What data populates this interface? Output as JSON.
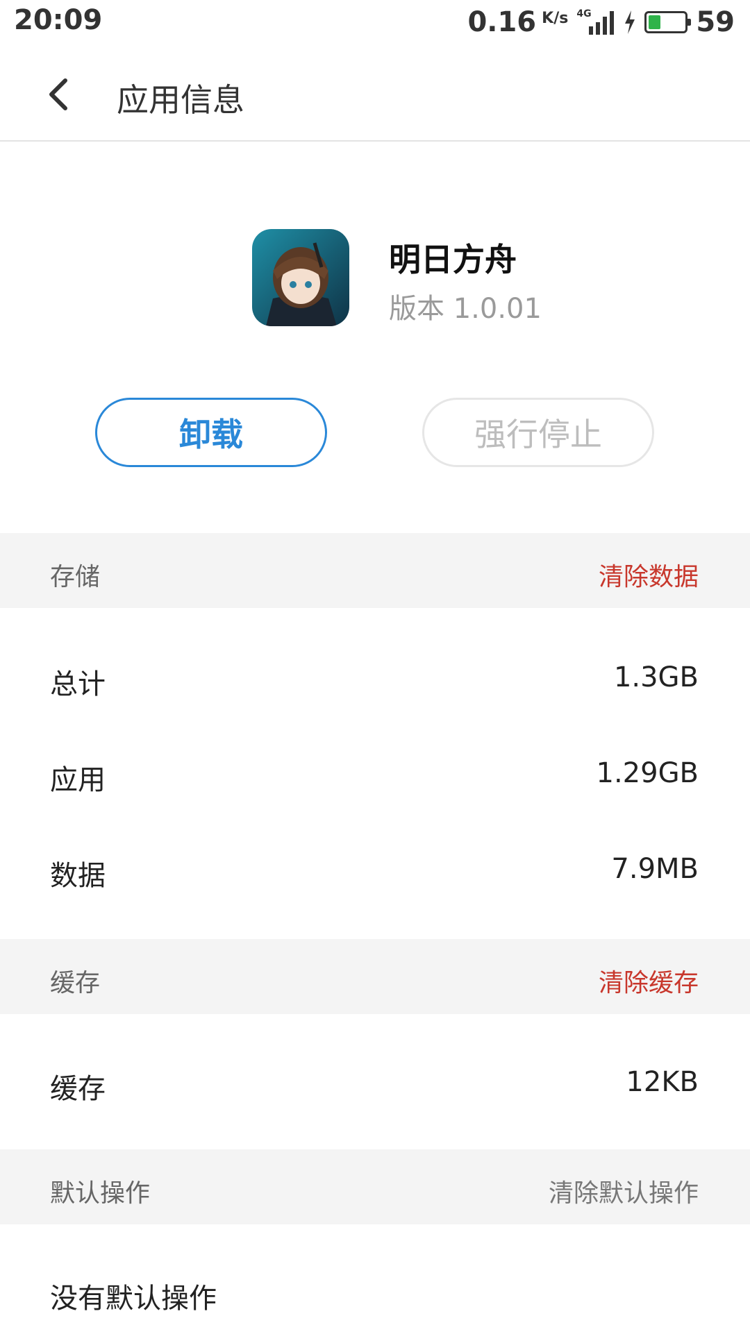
{
  "status_bar": {
    "time": "20:09",
    "net_speed": "0.16",
    "net_unit": "K/s",
    "network_type": "4G",
    "battery": "59",
    "battery_color": "#2fb34a"
  },
  "header": {
    "title": "应用信息",
    "back_icon": "chevron-left-icon"
  },
  "app": {
    "name": "明日方舟",
    "version": "版本 1.0.01",
    "uninstall_label": "卸载",
    "force_stop_label": "强行停止"
  },
  "storage": {
    "header": "存储",
    "action": "清除数据",
    "rows": [
      {
        "label": "总计",
        "value": "1.3GB"
      },
      {
        "label": "应用",
        "value": "1.29GB"
      },
      {
        "label": "数据",
        "value": "7.9MB"
      }
    ]
  },
  "cache": {
    "header": "缓存",
    "action": "清除缓存",
    "rows": [
      {
        "label": "缓存",
        "value": "12KB"
      }
    ]
  },
  "defaults": {
    "header": "默认操作",
    "action": "清除默认操作",
    "rows": [
      {
        "label": "没有默认操作"
      }
    ]
  },
  "colors": {
    "accent": "#2a88d8",
    "danger": "#c8372c",
    "section_bg": "#f4f4f4"
  }
}
